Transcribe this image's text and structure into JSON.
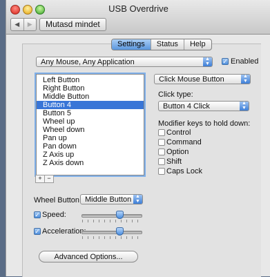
{
  "window": {
    "title": "USB Overdrive"
  },
  "toolbar": {
    "back_label": "◀",
    "forward_label": "▶",
    "show_all_label": "Mutasd mindet"
  },
  "tabs": [
    {
      "label": "Settings",
      "active": true
    },
    {
      "label": "Status",
      "active": false
    },
    {
      "label": "Help",
      "active": false
    }
  ],
  "device_popup": {
    "value": "Any Mouse, Any Application",
    "icon": "up-down-arrows-icon"
  },
  "enabled": {
    "label": "Enabled",
    "checked": true
  },
  "button_list": {
    "items": [
      "Left Button",
      "Right Button",
      "Middle Button",
      "Button 4",
      "Button 5",
      "Wheel up",
      "Wheel down",
      "Pan up",
      "Pan down",
      "Z Axis up",
      "Z Axis down"
    ],
    "selected": "Button 4",
    "add_label": "+",
    "remove_label": "−"
  },
  "action_popup": {
    "value": "Click Mouse Button"
  },
  "click_type": {
    "label": "Click type:",
    "value": "Button 4 Click"
  },
  "modifiers": {
    "label": "Modifier keys to hold down:",
    "items": [
      {
        "label": "Control",
        "checked": false
      },
      {
        "label": "Command",
        "checked": false
      },
      {
        "label": "Option",
        "checked": false
      },
      {
        "label": "Shift",
        "checked": false
      },
      {
        "label": "Caps Lock",
        "checked": false
      }
    ]
  },
  "wheel_button": {
    "label": "Wheel Button:",
    "value": "Middle Button"
  },
  "speed": {
    "label": "Speed:",
    "checked": true,
    "level": 0.64
  },
  "acceleration": {
    "label": "Acceleration:",
    "checked": true,
    "level": 0.64
  },
  "advanced_button": {
    "label": "Advanced Options..."
  },
  "colors": {
    "accent": "#3875d7",
    "window": "#e8e8e8",
    "desktop": "#5a6c86"
  }
}
